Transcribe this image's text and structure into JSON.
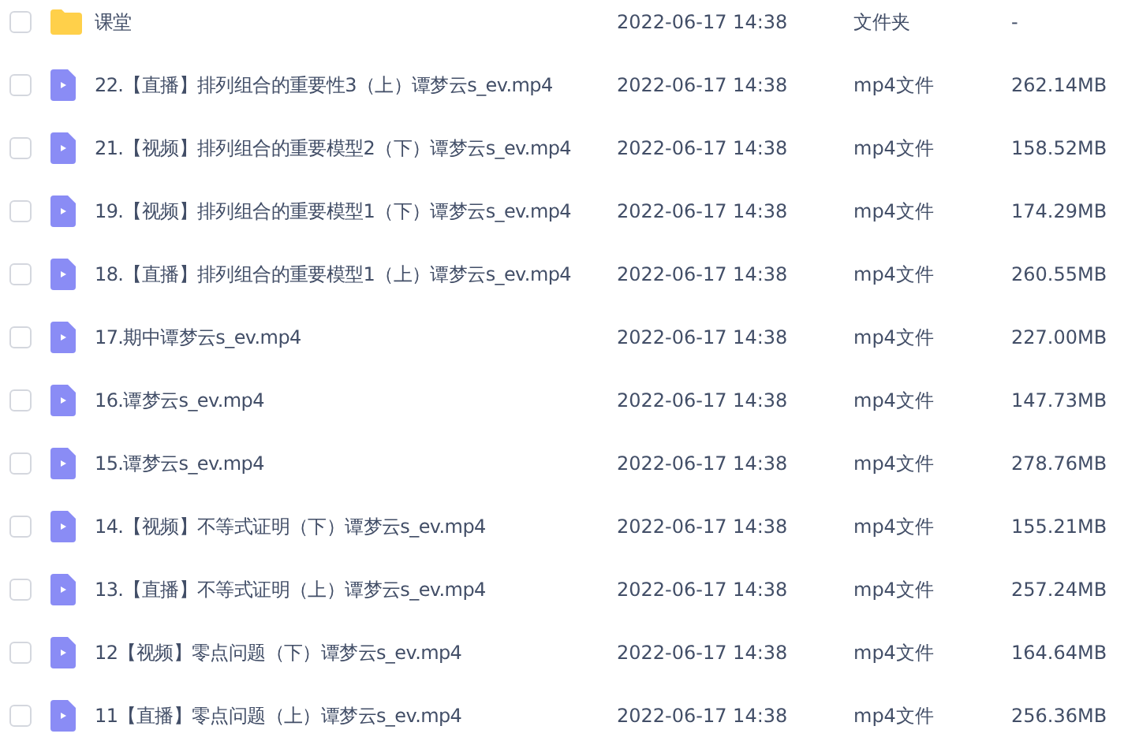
{
  "files": [
    {
      "kind": "folder",
      "checked": false,
      "name": "课堂",
      "modified": "2022-06-17 14:38",
      "type": "文件夹",
      "size": "-"
    },
    {
      "kind": "video",
      "checked": false,
      "name": "22.【直播】排列组合的重要性3（上）谭梦云s_ev.mp4",
      "modified": "2022-06-17 14:38",
      "type": "mp4文件",
      "size": "262.14MB"
    },
    {
      "kind": "video",
      "checked": false,
      "name": "21.【视频】排列组合的重要模型2（下）谭梦云s_ev.mp4",
      "modified": "2022-06-17 14:38",
      "type": "mp4文件",
      "size": "158.52MB"
    },
    {
      "kind": "video",
      "checked": false,
      "name": "19.【视频】排列组合的重要模型1（下）谭梦云s_ev.mp4",
      "modified": "2022-06-17 14:38",
      "type": "mp4文件",
      "size": "174.29MB"
    },
    {
      "kind": "video",
      "checked": false,
      "name": "18.【直播】排列组合的重要模型1（上）谭梦云s_ev.mp4",
      "modified": "2022-06-17 14:38",
      "type": "mp4文件",
      "size": "260.55MB"
    },
    {
      "kind": "video",
      "checked": false,
      "name": "17.期中谭梦云s_ev.mp4",
      "modified": "2022-06-17 14:38",
      "type": "mp4文件",
      "size": "227.00MB"
    },
    {
      "kind": "video",
      "checked": false,
      "name": "16.谭梦云s_ev.mp4",
      "modified": "2022-06-17 14:38",
      "type": "mp4文件",
      "size": "147.73MB"
    },
    {
      "kind": "video",
      "checked": false,
      "name": "15.谭梦云s_ev.mp4",
      "modified": "2022-06-17 14:38",
      "type": "mp4文件",
      "size": "278.76MB"
    },
    {
      "kind": "video",
      "checked": false,
      "name": "14.【视频】不等式证明（下）谭梦云s_ev.mp4",
      "modified": "2022-06-17 14:38",
      "type": "mp4文件",
      "size": "155.21MB"
    },
    {
      "kind": "video",
      "checked": false,
      "name": "13.【直播】不等式证明（上）谭梦云s_ev.mp4",
      "modified": "2022-06-17 14:38",
      "type": "mp4文件",
      "size": "257.24MB"
    },
    {
      "kind": "video",
      "checked": false,
      "name": "12【视频】零点问题（下）谭梦云s_ev.mp4",
      "modified": "2022-06-17 14:38",
      "type": "mp4文件",
      "size": "164.64MB"
    },
    {
      "kind": "video",
      "checked": false,
      "name": "11【直播】零点问题（上）谭梦云s_ev.mp4",
      "modified": "2022-06-17 14:38",
      "type": "mp4文件",
      "size": "256.36MB"
    }
  ]
}
